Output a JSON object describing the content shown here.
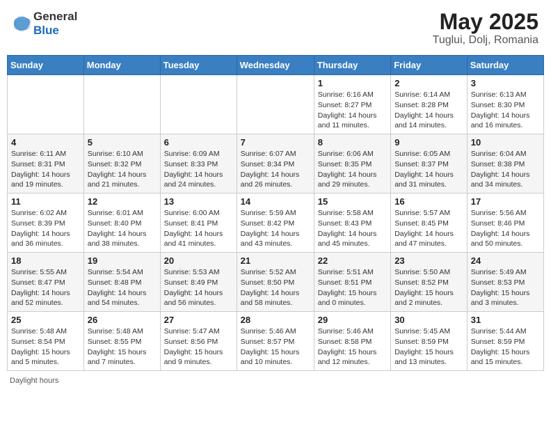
{
  "header": {
    "logo_general": "General",
    "logo_blue": "Blue",
    "title": "May 2025",
    "subtitle": "Tuglui, Dolj, Romania"
  },
  "days_of_week": [
    "Sunday",
    "Monday",
    "Tuesday",
    "Wednesday",
    "Thursday",
    "Friday",
    "Saturday"
  ],
  "weeks": [
    [
      {
        "day": "",
        "info": ""
      },
      {
        "day": "",
        "info": ""
      },
      {
        "day": "",
        "info": ""
      },
      {
        "day": "",
        "info": ""
      },
      {
        "day": "1",
        "info": "Sunrise: 6:16 AM\nSunset: 8:27 PM\nDaylight: 14 hours and 11 minutes."
      },
      {
        "day": "2",
        "info": "Sunrise: 6:14 AM\nSunset: 8:28 PM\nDaylight: 14 hours and 14 minutes."
      },
      {
        "day": "3",
        "info": "Sunrise: 6:13 AM\nSunset: 8:30 PM\nDaylight: 14 hours and 16 minutes."
      }
    ],
    [
      {
        "day": "4",
        "info": "Sunrise: 6:11 AM\nSunset: 8:31 PM\nDaylight: 14 hours and 19 minutes."
      },
      {
        "day": "5",
        "info": "Sunrise: 6:10 AM\nSunset: 8:32 PM\nDaylight: 14 hours and 21 minutes."
      },
      {
        "day": "6",
        "info": "Sunrise: 6:09 AM\nSunset: 8:33 PM\nDaylight: 14 hours and 24 minutes."
      },
      {
        "day": "7",
        "info": "Sunrise: 6:07 AM\nSunset: 8:34 PM\nDaylight: 14 hours and 26 minutes."
      },
      {
        "day": "8",
        "info": "Sunrise: 6:06 AM\nSunset: 8:35 PM\nDaylight: 14 hours and 29 minutes."
      },
      {
        "day": "9",
        "info": "Sunrise: 6:05 AM\nSunset: 8:37 PM\nDaylight: 14 hours and 31 minutes."
      },
      {
        "day": "10",
        "info": "Sunrise: 6:04 AM\nSunset: 8:38 PM\nDaylight: 14 hours and 34 minutes."
      }
    ],
    [
      {
        "day": "11",
        "info": "Sunrise: 6:02 AM\nSunset: 8:39 PM\nDaylight: 14 hours and 36 minutes."
      },
      {
        "day": "12",
        "info": "Sunrise: 6:01 AM\nSunset: 8:40 PM\nDaylight: 14 hours and 38 minutes."
      },
      {
        "day": "13",
        "info": "Sunrise: 6:00 AM\nSunset: 8:41 PM\nDaylight: 14 hours and 41 minutes."
      },
      {
        "day": "14",
        "info": "Sunrise: 5:59 AM\nSunset: 8:42 PM\nDaylight: 14 hours and 43 minutes."
      },
      {
        "day": "15",
        "info": "Sunrise: 5:58 AM\nSunset: 8:43 PM\nDaylight: 14 hours and 45 minutes."
      },
      {
        "day": "16",
        "info": "Sunrise: 5:57 AM\nSunset: 8:45 PM\nDaylight: 14 hours and 47 minutes."
      },
      {
        "day": "17",
        "info": "Sunrise: 5:56 AM\nSunset: 8:46 PM\nDaylight: 14 hours and 50 minutes."
      }
    ],
    [
      {
        "day": "18",
        "info": "Sunrise: 5:55 AM\nSunset: 8:47 PM\nDaylight: 14 hours and 52 minutes."
      },
      {
        "day": "19",
        "info": "Sunrise: 5:54 AM\nSunset: 8:48 PM\nDaylight: 14 hours and 54 minutes."
      },
      {
        "day": "20",
        "info": "Sunrise: 5:53 AM\nSunset: 8:49 PM\nDaylight: 14 hours and 56 minutes."
      },
      {
        "day": "21",
        "info": "Sunrise: 5:52 AM\nSunset: 8:50 PM\nDaylight: 14 hours and 58 minutes."
      },
      {
        "day": "22",
        "info": "Sunrise: 5:51 AM\nSunset: 8:51 PM\nDaylight: 15 hours and 0 minutes."
      },
      {
        "day": "23",
        "info": "Sunrise: 5:50 AM\nSunset: 8:52 PM\nDaylight: 15 hours and 2 minutes."
      },
      {
        "day": "24",
        "info": "Sunrise: 5:49 AM\nSunset: 8:53 PM\nDaylight: 15 hours and 3 minutes."
      }
    ],
    [
      {
        "day": "25",
        "info": "Sunrise: 5:48 AM\nSunset: 8:54 PM\nDaylight: 15 hours and 5 minutes."
      },
      {
        "day": "26",
        "info": "Sunrise: 5:48 AM\nSunset: 8:55 PM\nDaylight: 15 hours and 7 minutes."
      },
      {
        "day": "27",
        "info": "Sunrise: 5:47 AM\nSunset: 8:56 PM\nDaylight: 15 hours and 9 minutes."
      },
      {
        "day": "28",
        "info": "Sunrise: 5:46 AM\nSunset: 8:57 PM\nDaylight: 15 hours and 10 minutes."
      },
      {
        "day": "29",
        "info": "Sunrise: 5:46 AM\nSunset: 8:58 PM\nDaylight: 15 hours and 12 minutes."
      },
      {
        "day": "30",
        "info": "Sunrise: 5:45 AM\nSunset: 8:59 PM\nDaylight: 15 hours and 13 minutes."
      },
      {
        "day": "31",
        "info": "Sunrise: 5:44 AM\nSunset: 8:59 PM\nDaylight: 15 hours and 15 minutes."
      }
    ]
  ],
  "footer": {
    "label": "Daylight hours"
  },
  "colors": {
    "header_bg": "#3a7fc1",
    "accent_blue": "#1a6bbf"
  }
}
